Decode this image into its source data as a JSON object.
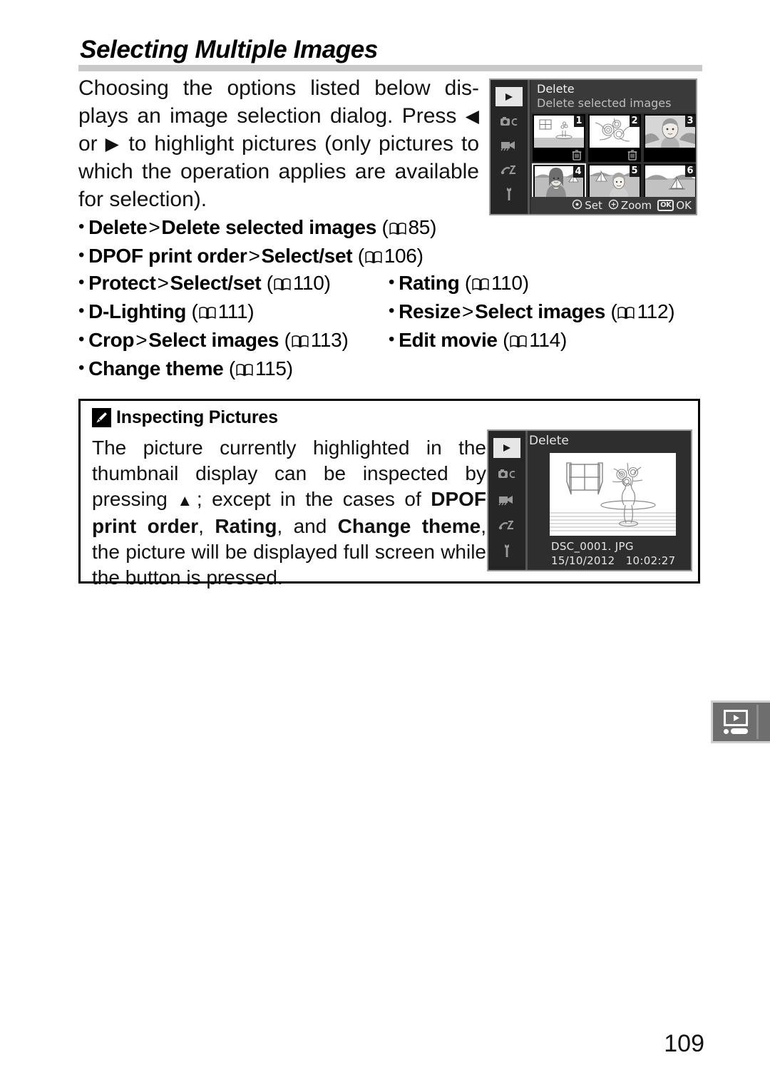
{
  "page": {
    "title": "Selecting Multiple Images",
    "number": "109"
  },
  "intro": {
    "part1": "Choosing the options listed below dis-plays an image selection dialog. Press ",
    "arrow_left": "◀",
    "part2": " or ",
    "arrow_right": "▶",
    "part3": " to highlight pictures (only pictures to which the operation applies are available for selection)."
  },
  "bullets_full": [
    {
      "bold1": "Delete",
      "sep": ">",
      "bold2": "Delete selected images",
      "page": "85"
    },
    {
      "bold1": "DPOF print order",
      "sep": ">",
      "bold2": "Select/set",
      "page": "106"
    }
  ],
  "bullets_left": [
    {
      "bold1": "Protect",
      "sep": ">",
      "bold2": "Select/set",
      "page": "110"
    },
    {
      "bold1": "D-Lighting",
      "sep": "",
      "bold2": "",
      "page": "111"
    },
    {
      "bold1": "Crop",
      "sep": ">",
      "bold2": "Select images",
      "page": "113"
    },
    {
      "bold1": "Change theme",
      "sep": "",
      "bold2": "",
      "page": "115"
    }
  ],
  "bullets_right": [
    {
      "bold1": "Rating",
      "sep": "",
      "bold2": "",
      "page": "110"
    },
    {
      "bold1": "Resize",
      "sep": ">",
      "bold2": "Select images",
      "page": "112"
    },
    {
      "bold1": "Edit movie",
      "sep": "",
      "bold2": "",
      "page": "114"
    }
  ],
  "note": {
    "icon": "pencil-icon",
    "title": "Inspecting Pictures",
    "text_1": "The picture currently highlighted in the thumbnail display can be inspected by pressing ",
    "arrow_up": "▲",
    "text_2": "; except in the cases of ",
    "bold_1": "DPOF print order",
    "text_3": ", ",
    "bold_2": "Rating",
    "text_4": ", and ",
    "bold_3": "Change theme",
    "text_5": ", the picture will be displayed full screen while the button is pressed."
  },
  "lcd_thumbnails": {
    "menu_title": "Delete",
    "menu_subtitle": "Delete selected images",
    "sidebar_icons": [
      "playback-icon",
      "shooting-menu-icon",
      "movie-icon",
      "retouch-icon",
      "setup-wrench-icon"
    ],
    "thumbnails": [
      {
        "number": "1",
        "scene": "window-vase",
        "marked": true,
        "selected": false
      },
      {
        "number": "2",
        "scene": "flowers",
        "marked": true,
        "selected": false
      },
      {
        "number": "3",
        "scene": "boy-portrait",
        "marked": false,
        "selected": false
      },
      {
        "number": "4",
        "scene": "woman-sea",
        "marked": true,
        "selected": true
      },
      {
        "number": "5",
        "scene": "boy-sea",
        "marked": false,
        "selected": false
      },
      {
        "number": "6",
        "scene": "seascape",
        "marked": false,
        "selected": false
      }
    ],
    "footer": [
      {
        "icon": "multi-selector-icon",
        "label": "Set"
      },
      {
        "icon": "zoom-icon",
        "label": "Zoom"
      },
      {
        "icon": "ok-button-icon",
        "label": "OK",
        "badge": "OK"
      }
    ]
  },
  "lcd_single": {
    "menu_title": "Delete",
    "sidebar_icons": [
      "playback-icon",
      "shooting-menu-icon",
      "movie-icon",
      "retouch-icon",
      "setup-wrench-icon"
    ],
    "filename": "DSC_0001. JPG",
    "date": "15/10/2012",
    "time": "10:02:27"
  },
  "tab_marker": {
    "icon": "playback-menu-tab-icon"
  },
  "colors": {
    "rule": "#c9c9c9",
    "lcd_background": "#2e2e2e",
    "lcd_sidebar": "#262626",
    "lcd_header": "#3a3a3a",
    "tab_marker": "#6e6e6e"
  }
}
